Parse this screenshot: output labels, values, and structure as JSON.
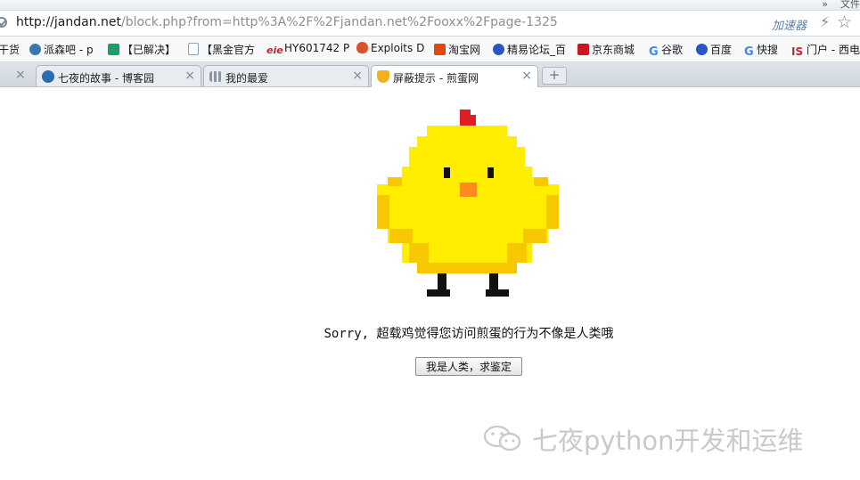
{
  "window": {
    "top_right_chevron": "»",
    "top_right_text": "文件"
  },
  "address_bar": {
    "url_host": "http://jandan.net",
    "url_rest": "/block.php?from=http%3A%2F%2Fjandan.net%2Fooxx%2Fpage-1325",
    "accelerator_label": "加速器",
    "bolt_glyph": "⚡",
    "star_glyph": "☆"
  },
  "bookmarks": [
    {
      "label": "干货",
      "icon": "none",
      "color": ""
    },
    {
      "label": "派森吧 - p",
      "icon": "python-icon",
      "color": "#3a78b0"
    },
    {
      "label": "【已解决】",
      "icon": "leaf-icon",
      "color": "#1e9e6a"
    },
    {
      "label": "【黑金官方",
      "icon": "page-icon",
      "color": "#8fa2b8"
    },
    {
      "label": "HY601742 P",
      "icon": "eie-icon",
      "color": "#c0272d"
    },
    {
      "label": "Exploits D",
      "icon": "bug-icon",
      "color": "#d9542b"
    },
    {
      "label": "淘宝网",
      "icon": "taobao-icon",
      "color": "#e0480f"
    },
    {
      "label": "精易论坛_百",
      "icon": "paw-icon",
      "color": "#2a55c4"
    },
    {
      "label": "京东商城",
      "icon": "jd-icon",
      "color": "#c81623"
    },
    {
      "label": "谷歌",
      "icon": "google-icon",
      "color": "#4285f4"
    },
    {
      "label": "百度",
      "icon": "paw-icon",
      "color": "#2a55c4"
    },
    {
      "label": "快搜",
      "icon": "google-icon",
      "color": "#4285f4"
    },
    {
      "label": "门户 - 西电",
      "icon": "xd-icon",
      "color": "#c0272d"
    }
  ],
  "tabs": [
    {
      "label": "七夜的故事 - 博客园",
      "icon": "blog-icon"
    },
    {
      "label": "我的最爱",
      "icon": "grid-icon"
    },
    {
      "label": "屏蔽提示 - 煎蛋网",
      "icon": "egg-icon"
    }
  ],
  "tab_close_glyph": "×",
  "new_tab_glyph": "+",
  "page": {
    "message": "Sorry, 超载鸡觉得您访问煎蛋的行为不像是人类哦",
    "button_label": "我是人类，求鉴定"
  },
  "watermark": {
    "text": "七夜python开发和运维"
  },
  "colors": {
    "chick_yellow": "#ffee00",
    "chick_shade": "#f7c800",
    "comb_red": "#e01e24",
    "beak_orange": "#ff8c1a",
    "leg_black": "#111111"
  }
}
